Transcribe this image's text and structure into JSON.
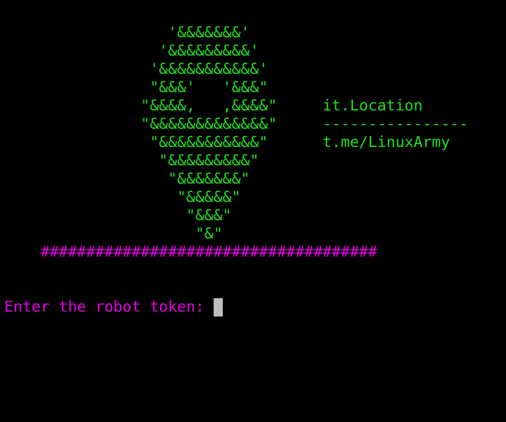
{
  "terminal": {
    "art_lines": [
      "                  '&&&&&&&'",
      "                 '&&&&&&&&&'",
      "                '&&&&&&&&&&&'",
      "                \"&&&'   '&&&\"",
      "               \"&&&&,   ,&&&&\"     it.Location",
      "               \"&&&&&&&&&&&&&\"     ----------------",
      "                \"&&&&&&&&&&&\"      t.me/LinuxArmy",
      "                 \"&&&&&&&&&\"",
      "                  \"&&&&&&&\"",
      "                   \"&&&&&\"",
      "                    \"&&&\"",
      "                     \"&\""
    ],
    "banner_hashes": "    #####################################",
    "prompt": "Enter the robot token: ",
    "colors": {
      "background": "#000000",
      "art": "#22dd22",
      "banner": "#e600e6",
      "prompt": "#e600e6",
      "cursor": "#bdbdbd"
    }
  }
}
